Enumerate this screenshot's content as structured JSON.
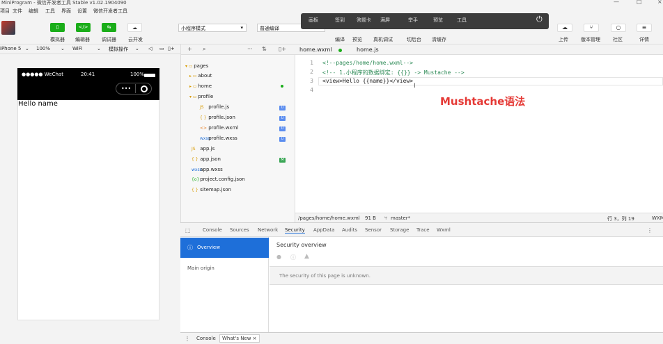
{
  "window": {
    "title": "MiniProgram - 微信开发者工具 Stable v1.02.1904090",
    "controls": [
      "—",
      "□",
      "×"
    ]
  },
  "menu": [
    "项目",
    "文件",
    "编辑",
    "工具",
    "界面",
    "设置",
    "微信开发者工具"
  ],
  "toolbar": {
    "buttons": [
      {
        "icon": "phone-icon",
        "glyph": "▯",
        "label": "模拟器"
      },
      {
        "icon": "code-icon",
        "glyph": "</>",
        "label": "编辑器"
      },
      {
        "icon": "debug-icon",
        "glyph": "⇆",
        "label": "调试器"
      },
      {
        "icon": "cloud-icon",
        "glyph": "☁",
        "label": "云开发"
      }
    ],
    "mode_select": "小程序模式",
    "compile_select": "普通编译",
    "center_labels": [
      "编译",
      "预览",
      "真机调试",
      "切后台",
      "清缓存"
    ],
    "right": [
      {
        "icon": "upload-icon",
        "glyph": "☁",
        "label": "上传"
      },
      {
        "icon": "branch-icon",
        "glyph": "⑂",
        "label": "版本管理"
      },
      {
        "icon": "chat-icon",
        "glyph": "○",
        "label": "社区"
      },
      {
        "icon": "menu-icon",
        "glyph": "≡",
        "label": "详情"
      }
    ]
  },
  "overlay": {
    "items": [
      "画板",
      "签到",
      "答题卡",
      "满屏",
      "举手",
      "预览",
      "工具"
    ]
  },
  "simulator": {
    "device": "iPhone 5",
    "zoom": "100%",
    "network": "WiFi",
    "action": "模拟操作",
    "status_carrier": "●●●●● WeChat",
    "status_time": "20:41",
    "status_battery": "100%",
    "content": "Hello name"
  },
  "tree_toolbar": [
    "+",
    "⌕",
    "···",
    "⇅",
    "▯+"
  ],
  "tree": [
    {
      "label": "pages",
      "icon": "folder-open-icon",
      "glyph": "▾ ▭",
      "indent": 0
    },
    {
      "label": "about",
      "icon": "folder-icon",
      "glyph": "▸ ▭",
      "indent": 1
    },
    {
      "label": "home",
      "icon": "folder-icon",
      "glyph": "▸ ▭",
      "indent": 1
    },
    {
      "label": "profile",
      "icon": "folder-open-icon",
      "glyph": "▾ ▭",
      "indent": 1
    },
    {
      "label": "profile.js",
      "icon": "js-file-icon",
      "glyph": "JS",
      "indent": 2
    },
    {
      "label": "profile.json",
      "icon": "json-file-icon",
      "glyph": "{ }",
      "indent": 2
    },
    {
      "label": "profile.wxml",
      "icon": "wxml-file-icon",
      "glyph": "<>",
      "indent": 2
    },
    {
      "label": "profile.wxss",
      "icon": "wxss-file-icon",
      "glyph": "wxss",
      "indent": 2
    },
    {
      "label": "app.js",
      "icon": "js-file-icon",
      "glyph": "JS",
      "indent": 0
    },
    {
      "label": "app.json",
      "icon": "json-file-icon",
      "glyph": "{ }",
      "indent": 0
    },
    {
      "label": "app.wxss",
      "icon": "wxss-file-icon",
      "glyph": "wxss",
      "indent": 0
    },
    {
      "label": "project.config.json",
      "icon": "config-file-icon",
      "glyph": "{o}",
      "indent": 0
    },
    {
      "label": "sitemap.json",
      "icon": "json-file-icon",
      "glyph": "{ }",
      "indent": 0
    }
  ],
  "badges": {
    "u": "U",
    "m": "M"
  },
  "editor": {
    "tabs": [
      "home.wxml",
      "home.js"
    ],
    "lines": [
      {
        "n": "1",
        "text": "<!--pages/home/home.wxml-->"
      },
      {
        "n": "2",
        "text": "<!-- 1.小程序的数据绑定: {{}} -> Mustache -->"
      },
      {
        "n": "3",
        "text": "<view>Hello {{name}}</view>"
      },
      {
        "n": "4",
        "text": ""
      }
    ],
    "annotation": "Mushtache语法"
  },
  "editor_status": {
    "path": "/pages/home/home.wxml",
    "size": "91 B",
    "branch": "master*",
    "position": "行 3，列 19",
    "lang": "WXML"
  },
  "devtools": {
    "tabs": [
      "Console",
      "Sources",
      "Network",
      "Security",
      "AppData",
      "Audits",
      "Sensor",
      "Storage",
      "Trace",
      "Wxml"
    ],
    "active_tab": "Security",
    "sidebar": [
      "Overview",
      "Main origin"
    ],
    "title": "Security overview",
    "unknown_text": "The security of this page is unknown.",
    "drawer_tabs": [
      "Console",
      "What's New ×"
    ]
  },
  "colors": {
    "accent_green": "#1aad19",
    "accent_blue": "#1e6fd9",
    "annotation_red": "#e53935"
  }
}
